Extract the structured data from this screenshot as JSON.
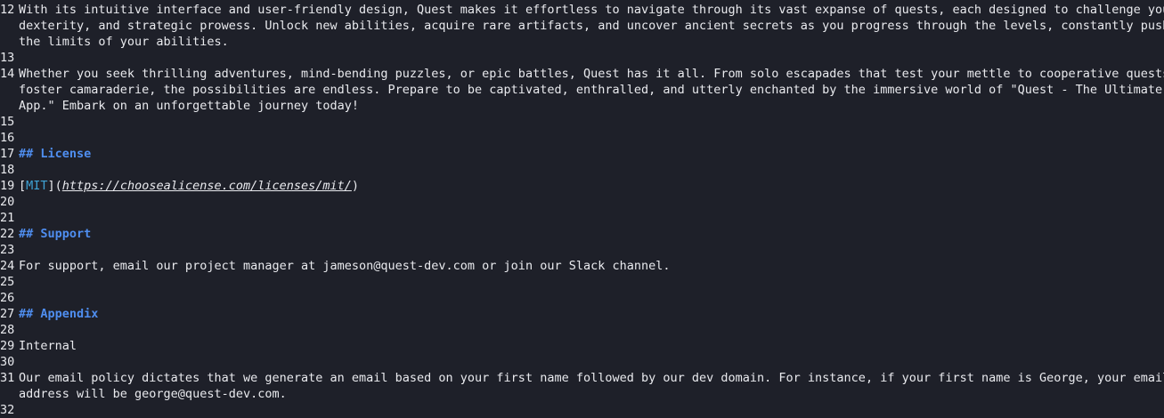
{
  "editor": {
    "lines": [
      {
        "number": "12",
        "wrapped": [
          "With its intuitive interface and user-friendly design, Quest makes it effortless to navigate through its vast expanse of quests, each designed to challenge your",
          "dexterity, and strategic prowess. Unlock new abilities, acquire rare artifacts, and uncover ancient secrets as you progress through the levels, constantly pushing",
          "the limits of your abilities."
        ]
      },
      {
        "number": "13"
      },
      {
        "number": "14",
        "wrapped": [
          "Whether you seek thrilling adventures, mind-bending puzzles, or epic battles, Quest has it all. From solo escapades that test your mettle to cooperative quests that",
          "foster camaraderie, the possibilities are endless. Prepare to be captivated, enthralled, and utterly enchanted by the immersive world of \"Quest - The Ultimate Web",
          "App.\" Embark on an unforgettable journey today!"
        ]
      },
      {
        "number": "15"
      },
      {
        "number": "16"
      },
      {
        "number": "17",
        "heading": "## License"
      },
      {
        "number": "18"
      },
      {
        "number": "19",
        "link": {
          "open_bracket": "[",
          "text": "MIT",
          "close_bracket": "](",
          "url": "https://choosealicense.com/licenses/mit/",
          "close_paren": ")"
        }
      },
      {
        "number": "20"
      },
      {
        "number": "21"
      },
      {
        "number": "22",
        "heading": "## Support"
      },
      {
        "number": "23"
      },
      {
        "number": "24",
        "wrapped": [
          "For support, email our project manager at jameson@quest-dev.com or join our Slack channel."
        ]
      },
      {
        "number": "25"
      },
      {
        "number": "26"
      },
      {
        "number": "27",
        "heading": "## Appendix"
      },
      {
        "number": "28"
      },
      {
        "number": "29",
        "wrapped": [
          "Internal"
        ]
      },
      {
        "number": "30"
      },
      {
        "number": "31",
        "wrapped": [
          "Our email policy dictates that we generate an email based on your first name followed by our dev domain. For instance, if your first name is George, your email",
          "address will be george@quest-dev.com."
        ]
      },
      {
        "number": "32"
      }
    ]
  }
}
